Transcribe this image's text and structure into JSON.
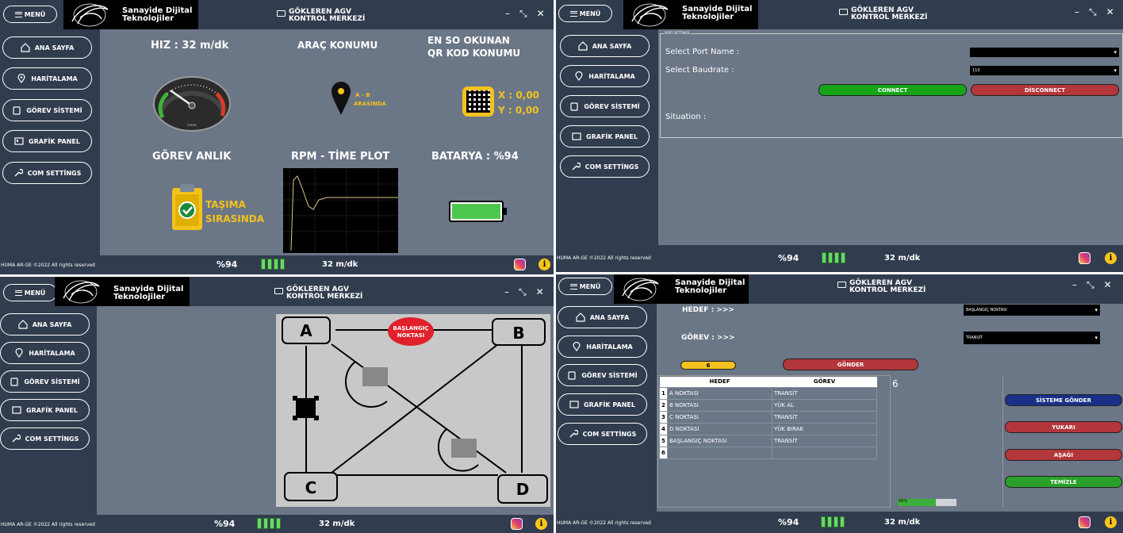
{
  "app": {
    "menu": "MENÜ",
    "logo_line1": "Sanayide Dijital",
    "logo_line2": "Teknolojiler",
    "title_line1": "GÖKLEREN AGV",
    "title_line2": "KONTROL MERKEZİ",
    "min": "–",
    "max": "⤡",
    "close": "✕"
  },
  "nav": {
    "home": "ANA SAYFA",
    "map": "HARİTALAMA",
    "task": "GÖREV SİSTEMİ",
    "graph": "GRAFİK PANEL",
    "com": "COM SETTİNGS"
  },
  "footer": {
    "copyright": "HUMA AR-GE ©2022  All rights reserved",
    "battery": "%94",
    "speed": "32 m/dk"
  },
  "dash": {
    "speed_label": "HIZ : 32 m/dk",
    "pos_label": "ARAÇ KONUMU",
    "qr_label1": "EN SO OKUNAN",
    "qr_label2": "QR KOD KONUMU",
    "location1": "A - B",
    "location2": "ARASINDA",
    "qr_x": "X : 0,00",
    "qr_y": "Y : 0,00",
    "task_label": "GÖREV ANLIK",
    "plot_label": "RPM - TİME PLOT",
    "battery_label": "BATARYA : %94",
    "task_state1": "TAŞIMA",
    "task_state2": "SIRASINDA",
    "gauge_text": "SPEED"
  },
  "com": {
    "group": "PORT SETTINGS",
    "port_label": "Select Port Name :",
    "port_value": "",
    "baud_label": "Select Baudrate :",
    "baud_value": "110",
    "connect": "CONNECT",
    "disconnect": "DİSCONNECT",
    "situation": "Situation :"
  },
  "map": {
    "start": "BAŞLANGIÇ",
    "start2": "NOKTASI",
    "nodes": [
      "A",
      "B",
      "C",
      "D"
    ]
  },
  "task": {
    "target_label": "HEDEF : >>>",
    "task_label": "GÖREV : >>>",
    "target_value": "BAŞLANGIÇ NOKTASI",
    "task_value": "TRANSİT",
    "count": "6",
    "send": "GÖNDER",
    "col_target": "HEDEF",
    "col_task": "GÖREV",
    "count2": "6",
    "rows": [
      {
        "n": "1",
        "t": "A NOKTASI",
        "g": "TRANSİT"
      },
      {
        "n": "2",
        "t": "B NOKTASI",
        "g": "YÜK AL"
      },
      {
        "n": "3",
        "t": "C NOKTASI",
        "g": "TRANSİT"
      },
      {
        "n": "4",
        "t": "D NOKTASI",
        "g": "YÜK BIRAK"
      },
      {
        "n": "5",
        "t": "BAŞLANGIÇ NOKTASI",
        "g": "TRANSİT"
      },
      {
        "n": "6",
        "t": "",
        "g": ""
      }
    ],
    "btn_send_sys": "SİSTEME GÖNDER",
    "btn_up": "YUKARI",
    "btn_down": "AŞAĞI",
    "btn_clear": "TEMİZLE",
    "progress_text": "65%",
    "progress": 0.65
  },
  "colors": {
    "dark": "#313c4e",
    "panel": "#6b7686",
    "green": "#17a517",
    "red": "#b3363a"
  }
}
